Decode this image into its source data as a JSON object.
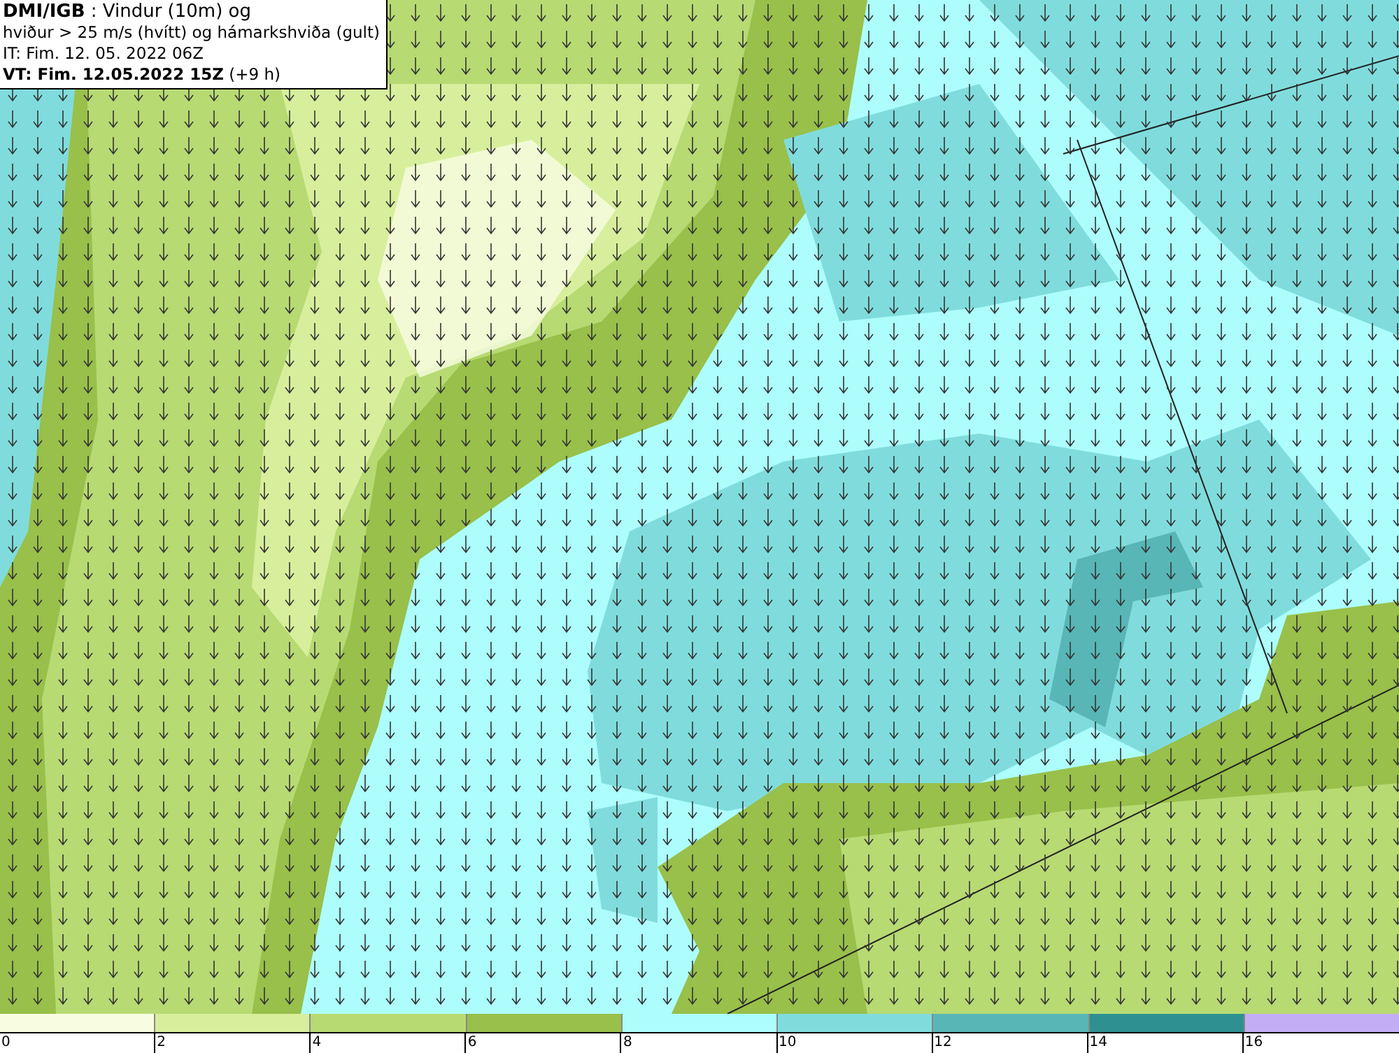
{
  "header": {
    "lines": [
      "**DMI/IGB** : Vindur (10m) og",
      "hviður > 25 m/s (hvítt) og hámarkshviða (gult)",
      "IT: Fim. 12. 05. 2022 06Z",
      "**VT: Fim. 12.05.2022 15Z** (+9 h)"
    ]
  },
  "legend": {
    "bins": [
      {
        "color": "#f8fde2"
      },
      {
        "color": "#d7ef9c"
      },
      {
        "color": "#b7da73"
      },
      {
        "color": "#98c04a"
      },
      {
        "color": "#adfdfd"
      },
      {
        "color": "#80dcdc"
      },
      {
        "color": "#58b6b6"
      },
      {
        "color": "#2e9090"
      },
      {
        "color": "#c3aef6"
      }
    ],
    "ticks": [
      "0",
      "2",
      "4",
      "6",
      "8",
      "10",
      "12",
      "14",
      "16"
    ]
  }
}
